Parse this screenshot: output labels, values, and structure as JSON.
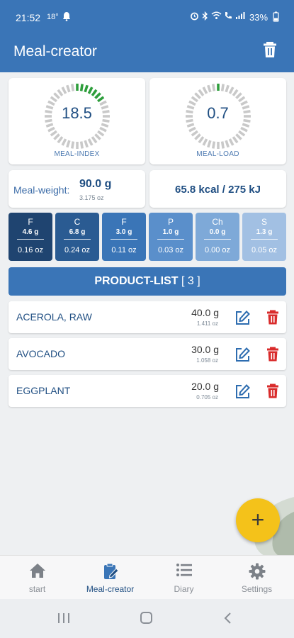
{
  "status": {
    "time": "21:52",
    "temp": "18°",
    "battery": "33%"
  },
  "appbar": {
    "title": "Meal-creator"
  },
  "gauges": [
    {
      "value": "18.5",
      "label": "MEAL-INDEX",
      "fill_fraction": 0.185,
      "fill_color": "#2e9e3c",
      "track_color": "#c9c9c9"
    },
    {
      "value": "0.7",
      "label": "MEAL-LOAD",
      "fill_fraction": 0.02,
      "fill_color": "#2e9e3c",
      "track_color": "#c9c9c9"
    }
  ],
  "meal_weight": {
    "label": "Meal-weight:",
    "value": "90.0 g",
    "oz": "3.175 oz"
  },
  "energy": {
    "value": "65.8 kcal / 275 kJ"
  },
  "nutrients": [
    {
      "letter": "F",
      "grams": "4.6 g",
      "oz": "0.16 oz",
      "color": "#1f4470"
    },
    {
      "letter": "C",
      "grams": "6.8 g",
      "oz": "0.24 oz",
      "color": "#2a5b92"
    },
    {
      "letter": "F",
      "grams": "3.0 g",
      "oz": "0.11 oz",
      "color": "#3a75b7"
    },
    {
      "letter": "P",
      "grams": "1.0 g",
      "oz": "0.03 oz",
      "color": "#5a8fcb"
    },
    {
      "letter": "Ch",
      "grams": "0.0 g",
      "oz": "0.00 oz",
      "color": "#7ea9d8"
    },
    {
      "letter": "S",
      "grams": "1.3 g",
      "oz": "0.05 oz",
      "color": "#a2c0e3"
    }
  ],
  "product_list": {
    "title": "PRODUCT-LIST",
    "count": "[ 3 ]"
  },
  "products": [
    {
      "name": "ACEROLA, RAW",
      "weight": "40.0 g",
      "oz": "1.411 oz"
    },
    {
      "name": "AVOCADO",
      "weight": "30.0 g",
      "oz": "1.058 oz"
    },
    {
      "name": "EGGPLANT",
      "weight": "20.0 g",
      "oz": "0.705 oz"
    }
  ],
  "fab": {
    "symbol": "+"
  },
  "bottom_nav": [
    {
      "label": "start",
      "icon": "home-icon"
    },
    {
      "label": "Meal-creator",
      "icon": "clipboard-edit-icon"
    },
    {
      "label": "Diary",
      "icon": "list-icon"
    },
    {
      "label": "Settings",
      "icon": "gear-icon"
    }
  ],
  "colors": {
    "primary": "#3a75b7",
    "dark_text": "#1f4e82",
    "accent_fab": "#f4c21a",
    "delete_red": "#d92b2b"
  }
}
